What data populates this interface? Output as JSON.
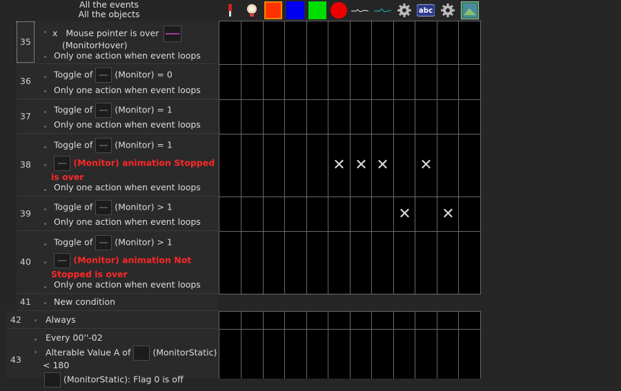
{
  "header": {
    "line1": "All the events",
    "line2": "All the objects"
  },
  "object_icons": [
    {
      "name": "lamp-red-icon",
      "color": "#cc2222"
    },
    {
      "name": "lightbulb-icon",
      "color": "#e8d4b0"
    },
    {
      "name": "red-orange-square-icon",
      "color": "#ff3300"
    },
    {
      "name": "blue-square-icon",
      "color": "#0000ee"
    },
    {
      "name": "green-square-icon",
      "color": "#00dd00"
    },
    {
      "name": "red-circle-icon",
      "color": "#ee0000"
    },
    {
      "name": "line-sprite-icon",
      "color": "#cccccc"
    },
    {
      "name": "teal-line-sprite-icon",
      "color": "#22aaaa"
    },
    {
      "name": "gear-icon",
      "color": "#bbbbbb"
    },
    {
      "name": "abc-text-icon",
      "color": "#2a3a8a"
    },
    {
      "name": "gear-icon",
      "color": "#bbbbbb"
    },
    {
      "name": "picture-icon",
      "color": "#3a8a5a"
    }
  ],
  "events": [
    {
      "num": "35",
      "lines": [
        {
          "prefix": "x",
          "text": "Mouse pointer is over",
          "thumb": "monitorhover"
        },
        {
          "text": "(MonitorHover)"
        },
        {
          "text": "Only one action when event loops"
        }
      ]
    },
    {
      "num": "36",
      "lines": [
        {
          "text_a": "Toggle of",
          "text_b": "(Monitor) = 0"
        },
        {
          "text": "Only one action when event loops"
        }
      ]
    },
    {
      "num": "37",
      "lines": [
        {
          "text_a": "Toggle of",
          "text_b": "(Monitor) = 1"
        },
        {
          "text": "Only one action when event loops"
        }
      ]
    },
    {
      "num": "38",
      "lines": [
        {
          "text_a": "Toggle of",
          "text_b": "(Monitor) = 1"
        },
        {
          "red": "(Monitor) animation Stopped"
        },
        {
          "red": "is over"
        },
        {
          "text": "Only one action when event loops"
        }
      ]
    },
    {
      "num": "39",
      "lines": [
        {
          "text_a": "Toggle of",
          "text_b": "(Monitor) > 1"
        },
        {
          "text": "Only one action when event loops"
        }
      ]
    },
    {
      "num": "40",
      "lines": [
        {
          "text_a": "Toggle of",
          "text_b": "(Monitor) > 1"
        },
        {
          "red": "(Monitor) animation Not"
        },
        {
          "red": "Stopped is over"
        },
        {
          "text": "Only one action when event loops"
        }
      ]
    },
    {
      "num": "41",
      "lines": [
        {
          "text": "New condition"
        }
      ]
    },
    {
      "num": "42",
      "lines": [
        {
          "text": "Always"
        }
      ]
    },
    {
      "num": "43",
      "lines": [
        {
          "text": "Every 00''-02"
        },
        {
          "text_a": "Alterable Value A of",
          "text_b": "(MonitorStatic)"
        },
        {
          "text": "< 180"
        },
        {
          "text": "(MonitorStatic): Flag 0 is off"
        }
      ]
    }
  ],
  "grid_marks": {
    "symbol": "✕",
    "event_38": [
      5,
      6,
      7,
      9
    ],
    "event_39": [
      8,
      10
    ]
  }
}
